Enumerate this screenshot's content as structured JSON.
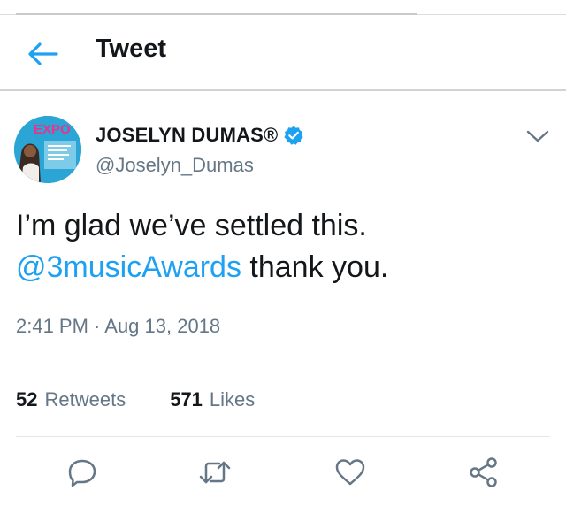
{
  "header": {
    "title": "Tweet"
  },
  "tweet": {
    "author": {
      "display_name": "JOSELYN DUMAS®",
      "handle": "@Joselyn_Dumas"
    },
    "avatar": {
      "logo_text": "EXPO"
    },
    "text_line1": "I’m glad we’ve settled this.",
    "mention": "@3musicAwards",
    "text_tail": " thank you.",
    "timestamp": "2:41 PM · Aug 13, 2018"
  },
  "stats": {
    "retweets_count": "52",
    "retweets_label": "Retweets",
    "likes_count": "571",
    "likes_label": "Likes"
  },
  "icons": {
    "back": "arrow-left-icon",
    "verified": "verified-badge-icon",
    "menu": "chevron-down-icon",
    "reply": "reply-icon",
    "retweet": "retweet-icon",
    "like": "heart-icon",
    "share": "share-icon"
  },
  "colors": {
    "accent": "#1da1f2",
    "muted": "#657786",
    "text": "#14171a"
  }
}
